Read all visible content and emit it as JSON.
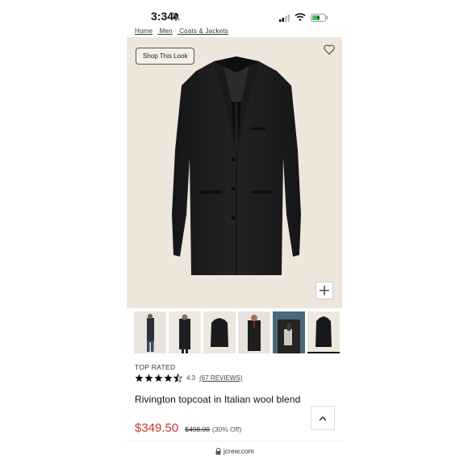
{
  "status": {
    "time": "3:34"
  },
  "breadcrumb": [
    "Home",
    "Men",
    "Coats & Jackets"
  ],
  "hero": {
    "shop_look_label": "Shop This Look"
  },
  "thumbnails": [
    {
      "name": "thumb-1"
    },
    {
      "name": "thumb-2"
    },
    {
      "name": "thumb-3"
    },
    {
      "name": "thumb-4"
    },
    {
      "name": "thumb-5"
    },
    {
      "name": "thumb-6"
    }
  ],
  "product": {
    "badge": "TOP RATED",
    "rating_value": "4.3",
    "rating_fraction": 0.86,
    "reviews_label": "(67 REVIEWS)",
    "name": "Rivington topcoat in Italian wool blend",
    "sale_price": "$349.50",
    "original_price": "$498.00",
    "discount": "(30% Off)"
  },
  "browser": {
    "url": "jcrew.com"
  },
  "colors": {
    "hero_bg": "#eee6db",
    "sale": "#c2372f",
    "coat": "#1c1c1e"
  }
}
